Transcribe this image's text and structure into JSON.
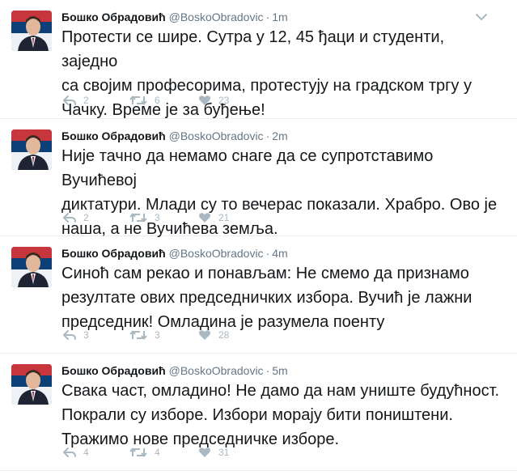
{
  "author": {
    "name": "Бошко Обрадовић",
    "handle": "@BoskoObradovic"
  },
  "colors": {
    "name": "#14171a",
    "meta": "#657786",
    "action": "#aab8c2",
    "divider": "#e6ecf0"
  },
  "icons": {
    "reply": "reply-icon",
    "retweet": "retweet-icon",
    "like": "heart-icon",
    "menu": "chevron-down-icon"
  },
  "tweets": [
    {
      "time": "1m",
      "text": "Протести се шире. Сутра у 12, 45 ђаци и студенти, заједно\nса својим професорима, протестују на градском тргу у\nЧачку. Време је за буђење!",
      "replies": "2",
      "retweets": "6",
      "likes": "23"
    },
    {
      "time": "2m",
      "text": "Није тачно да немамо снаге да се супротставимо Вучићевој\nдиктатури. Млади су то вечерас показали. Храбро. Ово је\nнаша, а не Вучићева земља.",
      "replies": "2",
      "retweets": "3",
      "likes": "21"
    },
    {
      "time": "4m",
      "text": "Синоћ сам рекао и понављам: Не смемо да признамо\nрезултате ових председничких избора. Вучић је лажни\nпредседник! Омладина је разумела поенту",
      "replies": "3",
      "retweets": "3",
      "likes": "28"
    },
    {
      "time": "5m",
      "text": "Свака част, омладино! Не дамо да нам униште будућност.\nПокрали су изборе. Избори морају бити поништени.\nТражимо нове председничке изборе.",
      "replies": "4",
      "retweets": "4",
      "likes": "31"
    }
  ]
}
